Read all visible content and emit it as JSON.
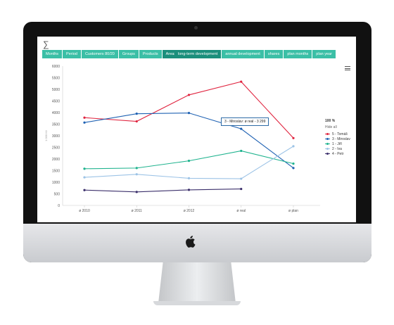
{
  "app": {
    "logo": "∑"
  },
  "tabs_left": [
    "Months",
    "Period",
    "Customers 80/20",
    "Groups",
    "Products",
    "Areas"
  ],
  "tabs_left_active": 5,
  "tabs_right": [
    "long-term development",
    "annual development",
    "shares",
    "plan months",
    "plan year"
  ],
  "tabs_right_active": 0,
  "legend": {
    "title": "100 %",
    "hide_all": "Hide all",
    "items": [
      {
        "label": "5 - Tomáš",
        "color": "#e0243f"
      },
      {
        "label": "3 - Miroslav",
        "color": "#1f62b3"
      },
      {
        "label": "1 - Jiří",
        "color": "#1fb38e"
      },
      {
        "label": "2 - Iva",
        "color": "#9cc3e6"
      },
      {
        "label": "4 - Petr",
        "color": "#3b2f6b"
      }
    ]
  },
  "tooltip": {
    "text": "3 - Miroslav: ø real - 3 299"
  },
  "chart_data": {
    "type": "line",
    "categories": [
      "ø 2010",
      "ø 2011",
      "ø 2012",
      "ø real",
      "ø plan"
    ],
    "ylabel": "1 000 Kč",
    "ylim": [
      0,
      6000
    ],
    "yticks": [
      0,
      500,
      1000,
      1500,
      2000,
      2500,
      3000,
      3500,
      4000,
      4500,
      5000,
      5500,
      6000
    ],
    "series": [
      {
        "name": "5 - Tomáš",
        "color": "#e0243f",
        "values": [
          3780,
          3620,
          4760,
          5330,
          2900
        ]
      },
      {
        "name": "3 - Miroslav",
        "color": "#1f62b3",
        "values": [
          3570,
          3950,
          3980,
          3299,
          1610
        ]
      },
      {
        "name": "1 - Jiří",
        "color": "#1fb38e",
        "values": [
          1580,
          1610,
          1920,
          2350,
          1800
        ]
      },
      {
        "name": "2 - Iva",
        "color": "#9cc3e6",
        "values": [
          1210,
          1340,
          1170,
          1150,
          2550
        ]
      },
      {
        "name": "4 - Petr",
        "color": "#3b2f6b",
        "values": [
          660,
          580,
          670,
          710,
          null
        ]
      }
    ]
  }
}
